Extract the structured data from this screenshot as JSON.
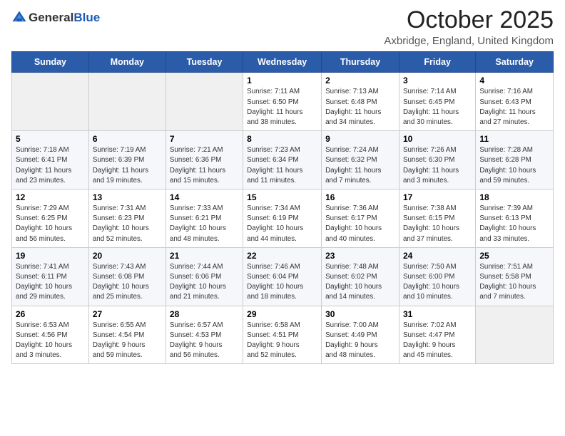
{
  "header": {
    "logo_general": "General",
    "logo_blue": "Blue",
    "main_title": "October 2025",
    "subtitle": "Axbridge, England, United Kingdom"
  },
  "calendar": {
    "weekdays": [
      "Sunday",
      "Monday",
      "Tuesday",
      "Wednesday",
      "Thursday",
      "Friday",
      "Saturday"
    ],
    "weeks": [
      [
        {
          "day": "",
          "info": ""
        },
        {
          "day": "",
          "info": ""
        },
        {
          "day": "",
          "info": ""
        },
        {
          "day": "1",
          "info": "Sunrise: 7:11 AM\nSunset: 6:50 PM\nDaylight: 11 hours\nand 38 minutes."
        },
        {
          "day": "2",
          "info": "Sunrise: 7:13 AM\nSunset: 6:48 PM\nDaylight: 11 hours\nand 34 minutes."
        },
        {
          "day": "3",
          "info": "Sunrise: 7:14 AM\nSunset: 6:45 PM\nDaylight: 11 hours\nand 30 minutes."
        },
        {
          "day": "4",
          "info": "Sunrise: 7:16 AM\nSunset: 6:43 PM\nDaylight: 11 hours\nand 27 minutes."
        }
      ],
      [
        {
          "day": "5",
          "info": "Sunrise: 7:18 AM\nSunset: 6:41 PM\nDaylight: 11 hours\nand 23 minutes."
        },
        {
          "day": "6",
          "info": "Sunrise: 7:19 AM\nSunset: 6:39 PM\nDaylight: 11 hours\nand 19 minutes."
        },
        {
          "day": "7",
          "info": "Sunrise: 7:21 AM\nSunset: 6:36 PM\nDaylight: 11 hours\nand 15 minutes."
        },
        {
          "day": "8",
          "info": "Sunrise: 7:23 AM\nSunset: 6:34 PM\nDaylight: 11 hours\nand 11 minutes."
        },
        {
          "day": "9",
          "info": "Sunrise: 7:24 AM\nSunset: 6:32 PM\nDaylight: 11 hours\nand 7 minutes."
        },
        {
          "day": "10",
          "info": "Sunrise: 7:26 AM\nSunset: 6:30 PM\nDaylight: 11 hours\nand 3 minutes."
        },
        {
          "day": "11",
          "info": "Sunrise: 7:28 AM\nSunset: 6:28 PM\nDaylight: 10 hours\nand 59 minutes."
        }
      ],
      [
        {
          "day": "12",
          "info": "Sunrise: 7:29 AM\nSunset: 6:25 PM\nDaylight: 10 hours\nand 56 minutes."
        },
        {
          "day": "13",
          "info": "Sunrise: 7:31 AM\nSunset: 6:23 PM\nDaylight: 10 hours\nand 52 minutes."
        },
        {
          "day": "14",
          "info": "Sunrise: 7:33 AM\nSunset: 6:21 PM\nDaylight: 10 hours\nand 48 minutes."
        },
        {
          "day": "15",
          "info": "Sunrise: 7:34 AM\nSunset: 6:19 PM\nDaylight: 10 hours\nand 44 minutes."
        },
        {
          "day": "16",
          "info": "Sunrise: 7:36 AM\nSunset: 6:17 PM\nDaylight: 10 hours\nand 40 minutes."
        },
        {
          "day": "17",
          "info": "Sunrise: 7:38 AM\nSunset: 6:15 PM\nDaylight: 10 hours\nand 37 minutes."
        },
        {
          "day": "18",
          "info": "Sunrise: 7:39 AM\nSunset: 6:13 PM\nDaylight: 10 hours\nand 33 minutes."
        }
      ],
      [
        {
          "day": "19",
          "info": "Sunrise: 7:41 AM\nSunset: 6:11 PM\nDaylight: 10 hours\nand 29 minutes."
        },
        {
          "day": "20",
          "info": "Sunrise: 7:43 AM\nSunset: 6:08 PM\nDaylight: 10 hours\nand 25 minutes."
        },
        {
          "day": "21",
          "info": "Sunrise: 7:44 AM\nSunset: 6:06 PM\nDaylight: 10 hours\nand 21 minutes."
        },
        {
          "day": "22",
          "info": "Sunrise: 7:46 AM\nSunset: 6:04 PM\nDaylight: 10 hours\nand 18 minutes."
        },
        {
          "day": "23",
          "info": "Sunrise: 7:48 AM\nSunset: 6:02 PM\nDaylight: 10 hours\nand 14 minutes."
        },
        {
          "day": "24",
          "info": "Sunrise: 7:50 AM\nSunset: 6:00 PM\nDaylight: 10 hours\nand 10 minutes."
        },
        {
          "day": "25",
          "info": "Sunrise: 7:51 AM\nSunset: 5:58 PM\nDaylight: 10 hours\nand 7 minutes."
        }
      ],
      [
        {
          "day": "26",
          "info": "Sunrise: 6:53 AM\nSunset: 4:56 PM\nDaylight: 10 hours\nand 3 minutes."
        },
        {
          "day": "27",
          "info": "Sunrise: 6:55 AM\nSunset: 4:54 PM\nDaylight: 9 hours\nand 59 minutes."
        },
        {
          "day": "28",
          "info": "Sunrise: 6:57 AM\nSunset: 4:53 PM\nDaylight: 9 hours\nand 56 minutes."
        },
        {
          "day": "29",
          "info": "Sunrise: 6:58 AM\nSunset: 4:51 PM\nDaylight: 9 hours\nand 52 minutes."
        },
        {
          "day": "30",
          "info": "Sunrise: 7:00 AM\nSunset: 4:49 PM\nDaylight: 9 hours\nand 48 minutes."
        },
        {
          "day": "31",
          "info": "Sunrise: 7:02 AM\nSunset: 4:47 PM\nDaylight: 9 hours\nand 45 minutes."
        },
        {
          "day": "",
          "info": ""
        }
      ]
    ]
  }
}
